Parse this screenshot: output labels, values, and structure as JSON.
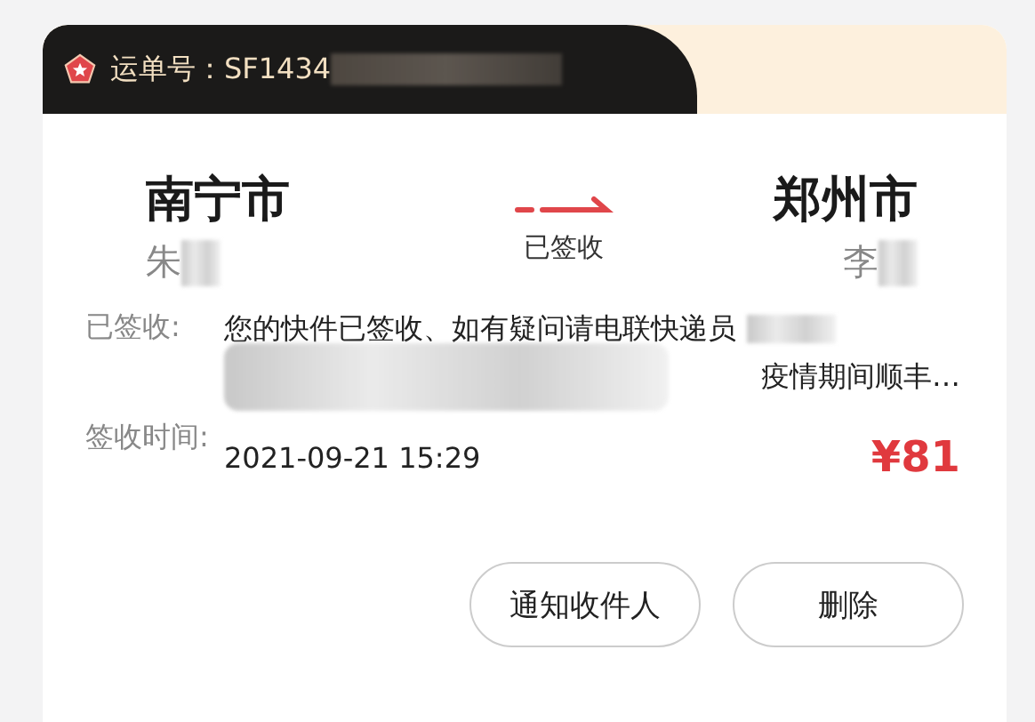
{
  "waybill": {
    "label": "运单号：SF1434"
  },
  "route": {
    "from": {
      "city": "南宁市",
      "person": "朱"
    },
    "status": "已签收",
    "to": {
      "city": "郑州市",
      "person": "李"
    }
  },
  "details": [
    {
      "label": "已签收:",
      "lines": [
        "您的快件已签收、如有疑问请电联快递员",
        "疫情期间顺丰…"
      ]
    },
    {
      "label": "签收时间:",
      "lines": [
        "2021-09-21 15:29"
      ]
    }
  ],
  "price": "¥81",
  "buttons": [
    "通知收件人",
    "删除"
  ]
}
